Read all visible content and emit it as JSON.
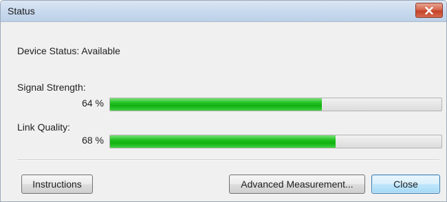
{
  "window": {
    "title": "Status"
  },
  "device_status": {
    "text": "Device Status: Available"
  },
  "signal_strength": {
    "label": "Signal Strength:",
    "percent_text": "64 %",
    "value": 0.64
  },
  "link_quality": {
    "label": "Link Quality:",
    "percent_text": "68 %",
    "value": 0.68
  },
  "buttons": {
    "instructions": "Instructions",
    "advanced_measurement": "Advanced Measurement...",
    "close": "Close"
  },
  "icons": {
    "window_close": "close-icon"
  },
  "colors": {
    "progress_fill": "#18b818",
    "titlebar": "#c8d9ee",
    "close_button": "#c5412a"
  }
}
